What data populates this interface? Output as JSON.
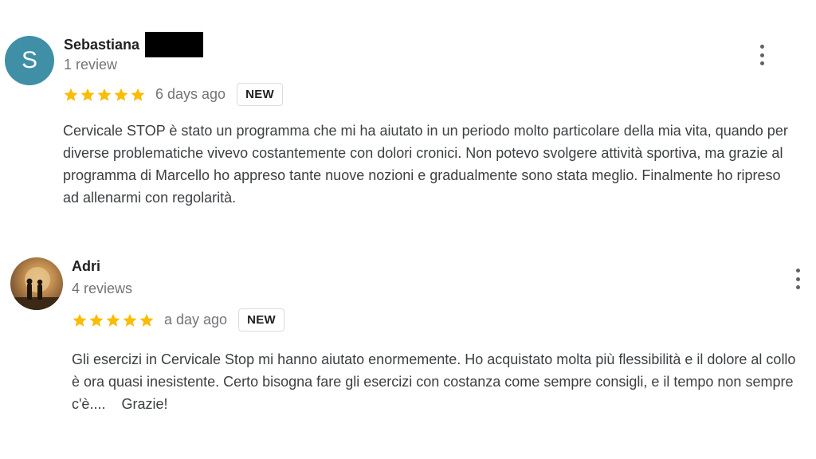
{
  "reviews": [
    {
      "avatar_letter": "S",
      "avatar_color": "#3f8fa7",
      "name": "Sebastiana",
      "review_count": "1 review",
      "rating": 5,
      "date": "6 days ago",
      "badge": "NEW",
      "text": "Cervicale STOP è stato un programma che mi ha aiutato in un periodo molto particolare della mia vita, quando per diverse problematiche vivevo costantemente con dolori cronici. Non potevo svolgere attività sportiva, ma grazie al programma di Marcello ho appreso tante nuove nozioni e gradualmente sono stata meglio. Finalmente ho ripreso ad allenarmi con regolarità."
    },
    {
      "name": "Adri",
      "review_count": "4 reviews",
      "rating": 5,
      "date": "a day ago",
      "badge": "NEW",
      "text": "Gli esercizi in Cervicale Stop mi hanno aiutato enormemente. Ho acquistato molta più flessibilità e il dolore al collo è ora quasi inesistente. Certo bisogna fare gli esercizi con costanza come sempre consigli, e il tempo non sempre c'è....    Grazie!"
    }
  ],
  "colors": {
    "star": "#fbbc04",
    "meta_text": "#70757a",
    "body_text": "#3c4043"
  },
  "icons": {
    "star": "star-icon",
    "more": "more-vert-icon"
  }
}
